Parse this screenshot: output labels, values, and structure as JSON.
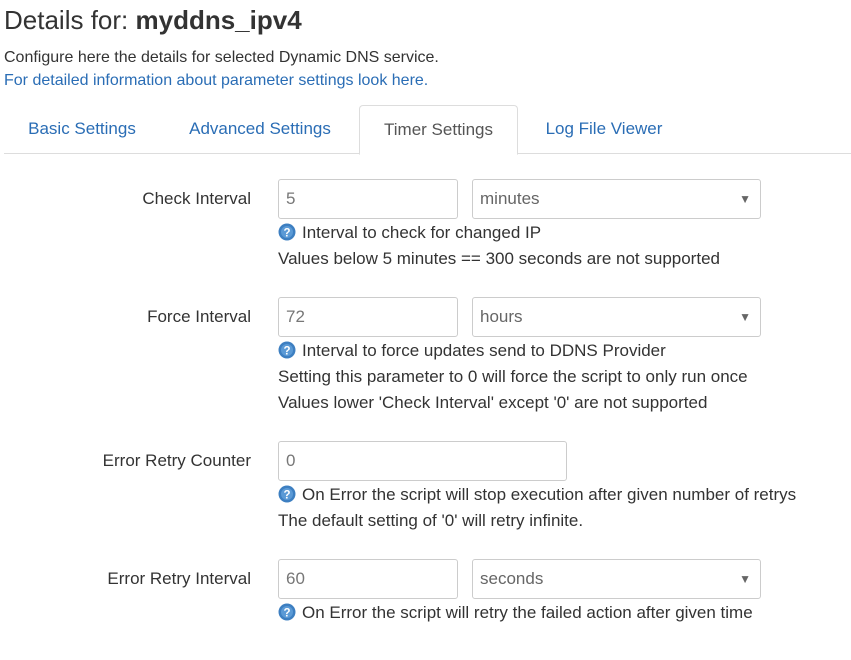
{
  "header": {
    "title_prefix": "Details for:",
    "section_name": "myddns_ipv4",
    "description": "Configure here the details for selected Dynamic DNS service.",
    "info_link": "For detailed information about parameter settings look here."
  },
  "tabs": [
    {
      "label": "Basic Settings",
      "active": false
    },
    {
      "label": "Advanced Settings",
      "active": false
    },
    {
      "label": "Timer Settings",
      "active": true
    },
    {
      "label": "Log File Viewer",
      "active": false
    }
  ],
  "fields": {
    "check_interval": {
      "label": "Check Interval",
      "value": "5",
      "unit": "minutes",
      "help": "Interval to check for changed IP",
      "notes": [
        "Values below 5 minutes == 300 seconds are not supported"
      ]
    },
    "force_interval": {
      "label": "Force Interval",
      "value": "72",
      "unit": "hours",
      "help": "Interval to force updates send to DDNS Provider",
      "notes": [
        "Setting this parameter to 0 will force the script to only run once",
        "Values lower 'Check Interval' except '0' are not supported"
      ]
    },
    "retry_count": {
      "label": "Error Retry Counter",
      "value": "0",
      "help": "On Error the script will stop execution after given number of retrys",
      "notes": [
        "The default setting of '0' will retry infinite."
      ]
    },
    "retry_interval": {
      "label": "Error Retry Interval",
      "value": "60",
      "unit": "seconds",
      "help": "On Error the script will retry the failed action after given time",
      "notes": []
    }
  },
  "icons": {
    "help": "help-icon",
    "dropdown": "chevron-down-icon"
  },
  "colors": {
    "link": "#2a6db5",
    "help_icon": "#3d7fc1",
    "border": "#dddddd"
  }
}
